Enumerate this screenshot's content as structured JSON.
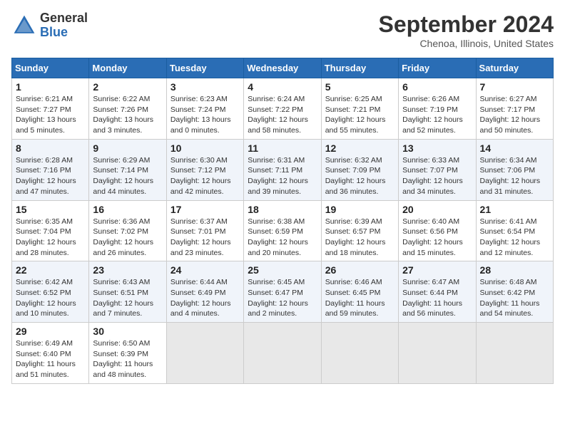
{
  "header": {
    "logo_general": "General",
    "logo_blue": "Blue",
    "month_title": "September 2024",
    "location": "Chenoa, Illinois, United States"
  },
  "days_of_week": [
    "Sunday",
    "Monday",
    "Tuesday",
    "Wednesday",
    "Thursday",
    "Friday",
    "Saturday"
  ],
  "weeks": [
    [
      {
        "day": "1",
        "info": "Sunrise: 6:21 AM\nSunset: 7:27 PM\nDaylight: 13 hours\nand 5 minutes."
      },
      {
        "day": "2",
        "info": "Sunrise: 6:22 AM\nSunset: 7:26 PM\nDaylight: 13 hours\nand 3 minutes."
      },
      {
        "day": "3",
        "info": "Sunrise: 6:23 AM\nSunset: 7:24 PM\nDaylight: 13 hours\nand 0 minutes."
      },
      {
        "day": "4",
        "info": "Sunrise: 6:24 AM\nSunset: 7:22 PM\nDaylight: 12 hours\nand 58 minutes."
      },
      {
        "day": "5",
        "info": "Sunrise: 6:25 AM\nSunset: 7:21 PM\nDaylight: 12 hours\nand 55 minutes."
      },
      {
        "day": "6",
        "info": "Sunrise: 6:26 AM\nSunset: 7:19 PM\nDaylight: 12 hours\nand 52 minutes."
      },
      {
        "day": "7",
        "info": "Sunrise: 6:27 AM\nSunset: 7:17 PM\nDaylight: 12 hours\nand 50 minutes."
      }
    ],
    [
      {
        "day": "8",
        "info": "Sunrise: 6:28 AM\nSunset: 7:16 PM\nDaylight: 12 hours\nand 47 minutes."
      },
      {
        "day": "9",
        "info": "Sunrise: 6:29 AM\nSunset: 7:14 PM\nDaylight: 12 hours\nand 44 minutes."
      },
      {
        "day": "10",
        "info": "Sunrise: 6:30 AM\nSunset: 7:12 PM\nDaylight: 12 hours\nand 42 minutes."
      },
      {
        "day": "11",
        "info": "Sunrise: 6:31 AM\nSunset: 7:11 PM\nDaylight: 12 hours\nand 39 minutes."
      },
      {
        "day": "12",
        "info": "Sunrise: 6:32 AM\nSunset: 7:09 PM\nDaylight: 12 hours\nand 36 minutes."
      },
      {
        "day": "13",
        "info": "Sunrise: 6:33 AM\nSunset: 7:07 PM\nDaylight: 12 hours\nand 34 minutes."
      },
      {
        "day": "14",
        "info": "Sunrise: 6:34 AM\nSunset: 7:06 PM\nDaylight: 12 hours\nand 31 minutes."
      }
    ],
    [
      {
        "day": "15",
        "info": "Sunrise: 6:35 AM\nSunset: 7:04 PM\nDaylight: 12 hours\nand 28 minutes."
      },
      {
        "day": "16",
        "info": "Sunrise: 6:36 AM\nSunset: 7:02 PM\nDaylight: 12 hours\nand 26 minutes."
      },
      {
        "day": "17",
        "info": "Sunrise: 6:37 AM\nSunset: 7:01 PM\nDaylight: 12 hours\nand 23 minutes."
      },
      {
        "day": "18",
        "info": "Sunrise: 6:38 AM\nSunset: 6:59 PM\nDaylight: 12 hours\nand 20 minutes."
      },
      {
        "day": "19",
        "info": "Sunrise: 6:39 AM\nSunset: 6:57 PM\nDaylight: 12 hours\nand 18 minutes."
      },
      {
        "day": "20",
        "info": "Sunrise: 6:40 AM\nSunset: 6:56 PM\nDaylight: 12 hours\nand 15 minutes."
      },
      {
        "day": "21",
        "info": "Sunrise: 6:41 AM\nSunset: 6:54 PM\nDaylight: 12 hours\nand 12 minutes."
      }
    ],
    [
      {
        "day": "22",
        "info": "Sunrise: 6:42 AM\nSunset: 6:52 PM\nDaylight: 12 hours\nand 10 minutes."
      },
      {
        "day": "23",
        "info": "Sunrise: 6:43 AM\nSunset: 6:51 PM\nDaylight: 12 hours\nand 7 minutes."
      },
      {
        "day": "24",
        "info": "Sunrise: 6:44 AM\nSunset: 6:49 PM\nDaylight: 12 hours\nand 4 minutes."
      },
      {
        "day": "25",
        "info": "Sunrise: 6:45 AM\nSunset: 6:47 PM\nDaylight: 12 hours\nand 2 minutes."
      },
      {
        "day": "26",
        "info": "Sunrise: 6:46 AM\nSunset: 6:45 PM\nDaylight: 11 hours\nand 59 minutes."
      },
      {
        "day": "27",
        "info": "Sunrise: 6:47 AM\nSunset: 6:44 PM\nDaylight: 11 hours\nand 56 minutes."
      },
      {
        "day": "28",
        "info": "Sunrise: 6:48 AM\nSunset: 6:42 PM\nDaylight: 11 hours\nand 54 minutes."
      }
    ],
    [
      {
        "day": "29",
        "info": "Sunrise: 6:49 AM\nSunset: 6:40 PM\nDaylight: 11 hours\nand 51 minutes."
      },
      {
        "day": "30",
        "info": "Sunrise: 6:50 AM\nSunset: 6:39 PM\nDaylight: 11 hours\nand 48 minutes."
      },
      {
        "day": "",
        "info": ""
      },
      {
        "day": "",
        "info": ""
      },
      {
        "day": "",
        "info": ""
      },
      {
        "day": "",
        "info": ""
      },
      {
        "day": "",
        "info": ""
      }
    ]
  ]
}
